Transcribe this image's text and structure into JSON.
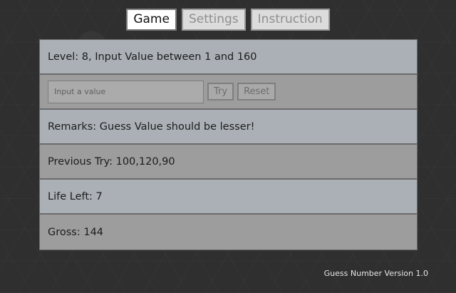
{
  "tabs": [
    {
      "label": "Game",
      "active": true
    },
    {
      "label": "Settings",
      "active": false
    },
    {
      "label": "Instruction",
      "active": false
    }
  ],
  "game": {
    "level_text": "Level: 8, Input Value between 1 and 160",
    "input": {
      "value": "",
      "placeholder": "Input a value"
    },
    "try_label": "Try",
    "reset_label": "Reset",
    "remarks": "Remarks: Guess Value should be lesser!",
    "previous_try": "Previous Try: 100,120,90",
    "life_left": "Life Left: 7",
    "gross": "Gross: 144"
  },
  "footer": {
    "version": "Guess Number Version 1.0"
  },
  "colors": {
    "background": "#2f2f2f",
    "row_light": "#aab0b6",
    "row_dark": "#9d9d9d",
    "tab_active": "#ffffff",
    "tab_inactive": "#dcdcdc"
  }
}
